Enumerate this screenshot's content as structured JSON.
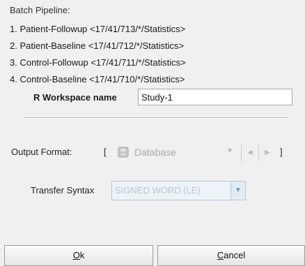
{
  "pipeline": {
    "title": "Batch Pipeline:",
    "items": [
      "1. Patient-Followup <17/41/713/*/Statistics>",
      "2. Patient-Baseline <17/41/712/*/Statistics>",
      "3. Control-Followup <17/41/711/*/Statistics>",
      "4. Control-Baseline <17/41/710/*/Statistics>"
    ]
  },
  "workspace": {
    "label": "R Workspace name",
    "value": "Study-1"
  },
  "output_format": {
    "label": "Output Format:",
    "open_bracket": "[",
    "close_bracket": "]",
    "selected": "Database",
    "icon": "database-icon"
  },
  "transfer_syntax": {
    "label": "Transfer Syntax",
    "selected": "SIGNED WORD (LE)"
  },
  "buttons": {
    "ok_mnemonic": "O",
    "ok_rest": "k",
    "cancel_mnemonic": "C",
    "cancel_rest": "ancel"
  },
  "colors": {
    "disabled_text": "#a8a8a8",
    "dialog_bg": "#f0f0f0"
  }
}
